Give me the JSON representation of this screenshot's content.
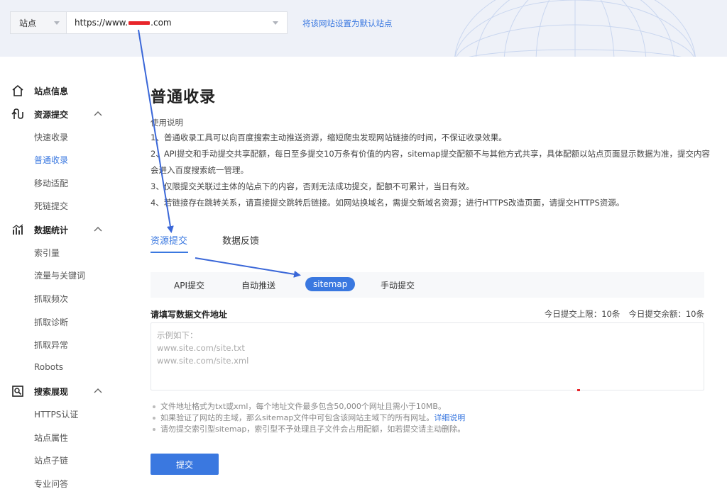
{
  "topbar": {
    "site_label": "站点",
    "url_prefix": "https://www.",
    "url_suffix": ".com",
    "set_default_link": "将该网站设置为默认站点"
  },
  "sidebar": {
    "groups": [
      {
        "label": "站点信息",
        "icon": "home-icon"
      },
      {
        "label": "资源提交",
        "icon": "upload-icon"
      },
      {
        "label": "数据统计",
        "icon": "chart-icon"
      },
      {
        "label": "搜索展现",
        "icon": "search-display-icon"
      }
    ],
    "items": [
      {
        "label": "快速收录"
      },
      {
        "label": "普通收录",
        "active": true
      },
      {
        "label": "移动适配"
      },
      {
        "label": "死链提交"
      },
      {
        "label": "索引量"
      },
      {
        "label": "流量与关键词"
      },
      {
        "label": "抓取频次"
      },
      {
        "label": "抓取诊断"
      },
      {
        "label": "抓取异常"
      },
      {
        "label": "Robots"
      },
      {
        "label": "HTTPS认证"
      },
      {
        "label": "站点属性"
      },
      {
        "label": "站点子链"
      },
      {
        "label": "专业问答"
      }
    ]
  },
  "main": {
    "title": "普通收录",
    "intro_heading": "使用说明",
    "intro_lines": [
      "1、普通收录工具可以向百度搜索主动推送资源，缩短爬虫发现网站链接的时间，不保证收录效果。",
      "2、API提交和手动提交共享配额，每日至多提交10万条有价值的内容，sitemap提交配额不与其他方式共享，具体配额以站点页面显示数据为准，提交内容会进入百度搜索统一管理。",
      "3、仅限提交关联过主体的站点下的内容，否则无法成功提交，配额不可累计，当日有效。",
      "4、若链接存在跳转关系，请直接提交跳转后链接。如网站换域名，需提交新域名资源；进行HTTPS改造页面，请提交HTTPS资源。"
    ],
    "tabs": [
      {
        "label": "资源提交",
        "active": true
      },
      {
        "label": "数据反馈"
      }
    ],
    "subtabs": [
      {
        "label": "API提交"
      },
      {
        "label": "自动推送"
      },
      {
        "label": "sitemap",
        "active": true
      },
      {
        "label": "手动提交"
      }
    ],
    "form_label": "请填写数据文件地址",
    "quota_limit": "今日提交上限：10条",
    "quota_remaining": "今日提交余额：10条",
    "placeholder_lines": [
      "示例如下：",
      "www.site.com/site.txt",
      "www.site.com/site.xml"
    ],
    "tips": [
      {
        "text": "文件地址格式为txt或xml，每个地址文件最多包含50,000个网址且需小于10MB。"
      },
      {
        "text": "如果验证了网站的主域，那么sitemap文件中可包含该网站主域下的所有网址。",
        "link": "详细说明"
      },
      {
        "text": "请勿提交索引型sitemap，索引型不予处理且子文件会占用配额，如若提交请主动删除。"
      }
    ],
    "submit_label": "提交"
  },
  "colors": {
    "accent": "#3a78e0",
    "redaction": "#e8252a",
    "annotation_arrow": "#3a67d8"
  }
}
